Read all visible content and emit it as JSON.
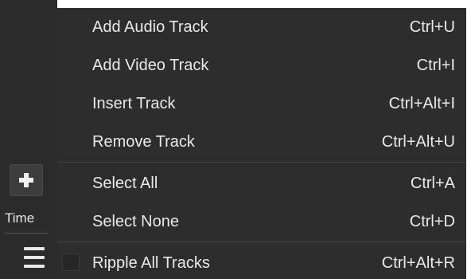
{
  "toolbar": {
    "add_icon": "plus-icon",
    "time_label": "Time",
    "menu_icon": "hamburger-icon"
  },
  "menu": {
    "groups": [
      [
        {
          "label": "Add Audio Track",
          "shortcut": "Ctrl+U"
        },
        {
          "label": "Add Video Track",
          "shortcut": "Ctrl+I"
        },
        {
          "label": "Insert Track",
          "shortcut": "Ctrl+Alt+I"
        },
        {
          "label": "Remove Track",
          "shortcut": "Ctrl+Alt+U"
        }
      ],
      [
        {
          "label": "Select All",
          "shortcut": "Ctrl+A"
        },
        {
          "label": "Select None",
          "shortcut": "Ctrl+D"
        }
      ],
      [
        {
          "label": "Ripple All Tracks",
          "shortcut": "Ctrl+Alt+R",
          "checkable": true,
          "checked": false
        }
      ]
    ]
  },
  "colors": {
    "menu_bg": "#2d2d2d",
    "text": "#e9e9e9",
    "separator": "#444444"
  }
}
